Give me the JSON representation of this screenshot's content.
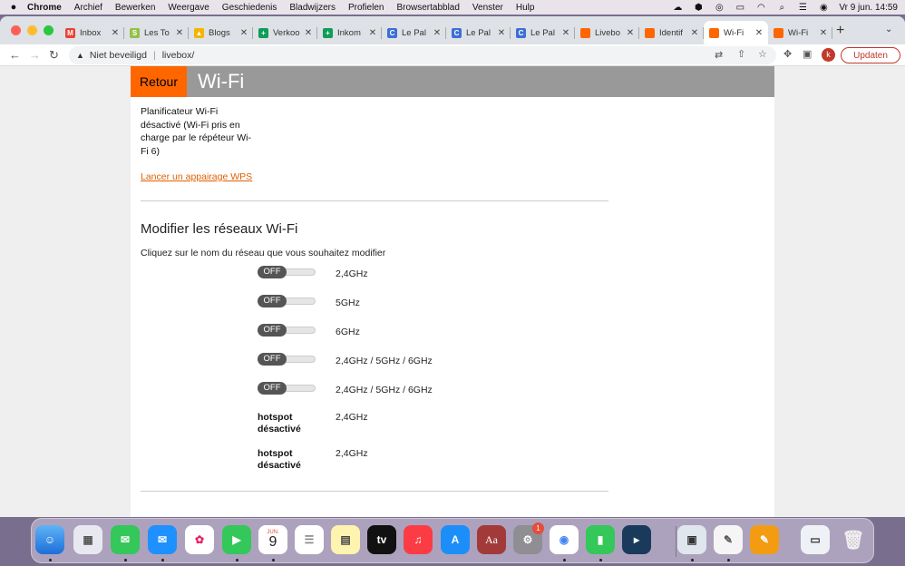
{
  "menubar": {
    "app": "Chrome",
    "items": [
      "Archief",
      "Bewerken",
      "Weergave",
      "Geschiedenis",
      "Bladwijzers",
      "Profielen",
      "Browsertabblad",
      "Venster",
      "Hulp"
    ],
    "clock": "Vr 9 jun.  14:59"
  },
  "tabs": [
    {
      "label": "Inbox",
      "favicon": "gmail",
      "color": "#ea4335",
      "glyph": "M"
    },
    {
      "label": "Les To",
      "favicon": "shopify",
      "color": "#95bf47",
      "glyph": "S"
    },
    {
      "label": "Blogs",
      "favicon": "google-drive",
      "color": "#f4b400",
      "glyph": "▲"
    },
    {
      "label": "Verkoo",
      "favicon": "google-sheets",
      "color": "#0f9d58",
      "glyph": "+"
    },
    {
      "label": "Inkom",
      "favicon": "google-sheets",
      "color": "#0f9d58",
      "glyph": "+"
    },
    {
      "label": "Le Pal",
      "favicon": "c-icon",
      "color": "#3b6fd6",
      "glyph": "C"
    },
    {
      "label": "Le Pal",
      "favicon": "c-icon",
      "color": "#3b6fd6",
      "glyph": "C"
    },
    {
      "label": "Le Pal",
      "favicon": "c-icon",
      "color": "#3b6fd6",
      "glyph": "C"
    },
    {
      "label": "Livebo",
      "favicon": "orange",
      "color": "#ff6600",
      "glyph": ""
    },
    {
      "label": "Identif",
      "favicon": "orange",
      "color": "#ff6600",
      "glyph": ""
    },
    {
      "label": "Wi-Fi",
      "favicon": "orange",
      "color": "#ff6600",
      "glyph": "",
      "active": true
    },
    {
      "label": "Wi-Fi",
      "favicon": "orange",
      "color": "#ff6600",
      "glyph": ""
    }
  ],
  "toolbar": {
    "security": "Niet beveiligd",
    "url": "livebox/",
    "avatar": "k",
    "update_label": "Updaten"
  },
  "page": {
    "back_label": "Retour",
    "title": "Wi-Fi",
    "scheduler_text": "Planificateur Wi-Fi désactivé (Wi-Fi pris en charge par le répéteur Wi-Fi 6)",
    "wps_link": "Lancer un appairage WPS",
    "modify_heading": "Modifier les réseaux Wi-Fi",
    "instructions": "Cliquez sur le nom du réseau que vous souhaitez modifier",
    "networks": [
      {
        "state": "OFF",
        "band": "2,4GHz"
      },
      {
        "state": "OFF",
        "band": "5GHz"
      },
      {
        "state": "OFF",
        "band": "6GHz"
      },
      {
        "state": "OFF",
        "band": "2,4GHz / 5GHz / 6GHz"
      },
      {
        "state": "OFF",
        "band": "2,4GHz / 5GHz / 6GHz"
      }
    ],
    "hotspots": [
      {
        "label": "hotspot désactivé",
        "band": "2,4GHz"
      },
      {
        "label": "hotspot désactivé",
        "band": "2,4GHz"
      }
    ]
  },
  "dock": {
    "calendar_month": "JUN.",
    "calendar_day": "9",
    "appletv_label": "tv",
    "dictionary_label": "Aa",
    "settings_badge": "1"
  }
}
